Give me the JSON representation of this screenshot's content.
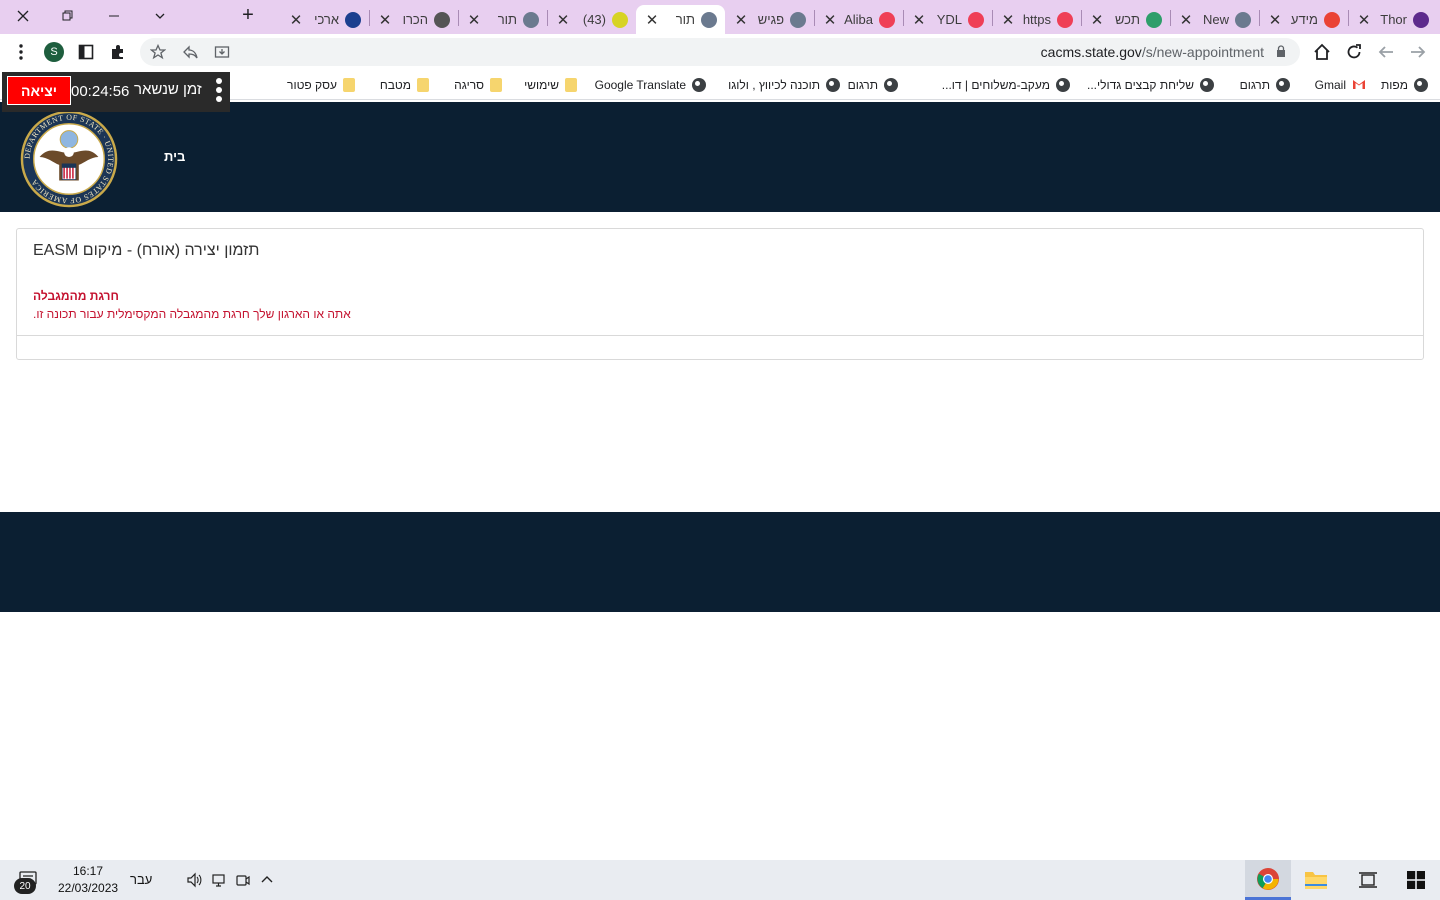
{
  "browser": {
    "tabs": [
      {
        "title": "Thor",
        "favicon": "e-logo-icon",
        "favicon_color": "#5d2a8c",
        "active": false
      },
      {
        "title": "מידע",
        "favicon": "gmail-icon",
        "favicon_color": "#ea4335",
        "active": false
      },
      {
        "title": "New",
        "favicon": "state-seal-icon",
        "favicon_color": "#6b7a8f",
        "active": false
      },
      {
        "title": "תכש",
        "favicon": "star-outline-icon",
        "favicon_color": "#2e9e6a",
        "active": false
      },
      {
        "title": "https",
        "favicon": "pocket-icon",
        "favicon_color": "#ef3f56",
        "active": false
      },
      {
        "title": "YDL",
        "favicon": "pocket-icon",
        "favicon_color": "#ef3f56",
        "active": false
      },
      {
        "title": "Aliba",
        "favicon": "pocket-icon",
        "favicon_color": "#ef3f56",
        "active": false
      },
      {
        "title": "פגיש",
        "favicon": "state-seal-icon",
        "favicon_color": "#6b7a8f",
        "active": false
      },
      {
        "title": "תור",
        "favicon": "state-seal-icon",
        "favicon_color": "#6b7a8f",
        "active": true
      },
      {
        "title": "(43)",
        "favicon": "cloud-icon",
        "favicon_color": "#d7d324",
        "active": false
      },
      {
        "title": "תור",
        "favicon": "state-seal-icon",
        "favicon_color": "#6b7a8f",
        "active": false
      },
      {
        "title": "הכרו",
        "favicon": "document-icon",
        "favicon_color": "#555555",
        "active": false
      },
      {
        "title": "ארכי",
        "favicon": "app-icon",
        "favicon_color": "#1c3f8f",
        "active": false
      }
    ],
    "url": {
      "host": "cacms.state.gov",
      "path": "/s/new-appointment"
    },
    "profile_initial": "S",
    "bookmarks": [
      {
        "label": "מפות",
        "icon": "globe-icon"
      },
      {
        "label": "Gmail",
        "icon": "gmail-icon"
      },
      {
        "label": "תרגום",
        "icon": "globe-icon"
      },
      {
        "label": "שליחת קבצים גדולי...",
        "icon": "globe-icon"
      },
      {
        "label": "מעקב-משלוחים | דו...",
        "icon": "globe-icon"
      },
      {
        "label": "תרגום",
        "icon": "globe-icon"
      },
      {
        "label": "תוכנה לכיווץ , ולוגו",
        "icon": "globe-icon"
      },
      {
        "label": "Google Translate",
        "icon": "globe-icon"
      },
      {
        "label": "שימושי",
        "icon": "folder-icon"
      },
      {
        "label": "סריגה",
        "icon": "folder-icon"
      },
      {
        "label": "מטבח",
        "icon": "folder-icon"
      },
      {
        "label": "עסק פטור",
        "icon": "folder-icon"
      }
    ]
  },
  "timer": {
    "exit_label": "יציאה",
    "value": "00:24:56",
    "label": "זמן שנשאר"
  },
  "site": {
    "home_label": "בית",
    "seal_text": "DEPARTMENT OF STATE · UNITED STATES OF AMERICA",
    "header_color": "#0b1f32"
  },
  "card": {
    "title": "תזמון יצירה (אורח) - מיקום EASM",
    "error_heading": "חרגת מהמגבלה",
    "error_message": "אתה או הארגון שלך חרגת מהמגבלה המקסימלית עבור תכונה זו.",
    "error_color": "#c4122f"
  },
  "taskbar": {
    "notification_count": "20",
    "time": "16:17",
    "date": "22/03/2023",
    "language": "עבר"
  }
}
